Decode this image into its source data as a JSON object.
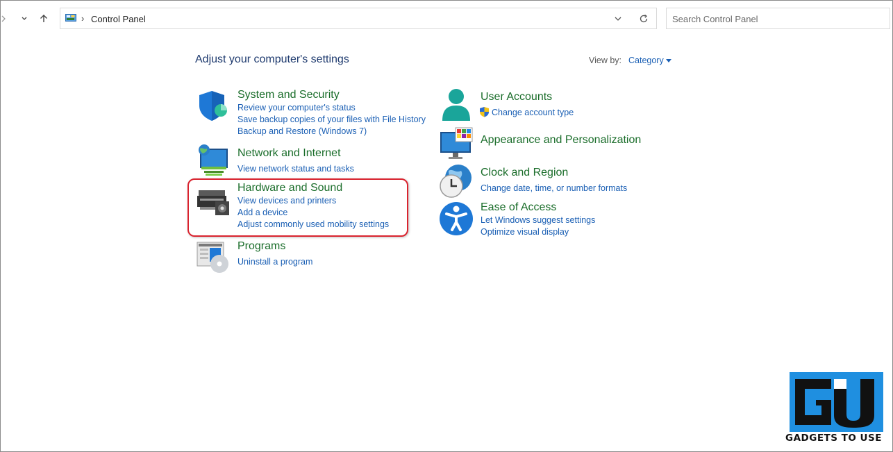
{
  "address_bar": {
    "path": "Control Panel"
  },
  "search": {
    "placeholder": "Search Control Panel"
  },
  "header": {
    "title": "Adjust your computer's settings",
    "view_by_label": "View by:",
    "view_by_value": "Category"
  },
  "categories": {
    "system": {
      "title": "System and Security",
      "links": [
        "Review your computer's status",
        "Save backup copies of your files with File History",
        "Backup and Restore (Windows 7)"
      ]
    },
    "network": {
      "title": "Network and Internet",
      "links": [
        "View network status and tasks"
      ]
    },
    "hardware": {
      "title": "Hardware and Sound",
      "links": [
        "View devices and printers",
        "Add a device",
        "Adjust commonly used mobility settings"
      ]
    },
    "programs": {
      "title": "Programs",
      "links": [
        "Uninstall a program"
      ]
    },
    "users": {
      "title": "User Accounts",
      "links": [
        "Change account type"
      ]
    },
    "appearance": {
      "title": "Appearance and Personalization",
      "links": []
    },
    "clock": {
      "title": "Clock and Region",
      "links": [
        "Change date, time, or number formats"
      ]
    },
    "ease": {
      "title": "Ease of Access",
      "links": [
        "Let Windows suggest settings",
        "Optimize visual display"
      ]
    }
  },
  "watermark": {
    "text": "GADGETS TO USE"
  },
  "colors": {
    "category_title": "#1a6d2a",
    "link": "#1a5fb4",
    "highlight": "#d9232e"
  }
}
